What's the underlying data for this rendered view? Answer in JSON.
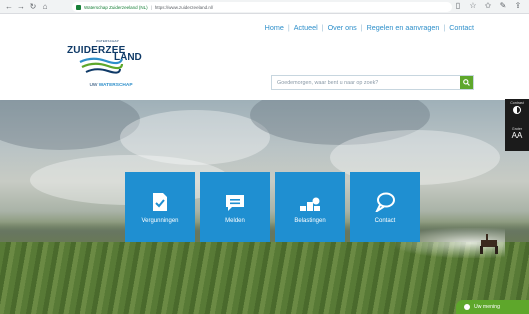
{
  "browser": {
    "site_name": "Waterschap Zuiderzeeland (NL)",
    "url": "https://www.zuiderzeeland.nl/"
  },
  "nav": {
    "items": [
      {
        "label": "Home"
      },
      {
        "label": "Actueel"
      },
      {
        "label": "Over ons"
      },
      {
        "label": "Regelen en aanvragen"
      },
      {
        "label": "Contact"
      }
    ],
    "separator": "|"
  },
  "logo": {
    "small_text": "WATERSCHAP",
    "name_part1": "ZUIDERZEE",
    "name_part2": "LAND",
    "tagline_prefix": "UW",
    "tagline_emph": "WATERSCHAP"
  },
  "search": {
    "placeholder": "Goedemorgen, waar bent u naar op zoek?",
    "button_icon": "search-icon"
  },
  "tiles": [
    {
      "label": "Vergunningen",
      "icon": "document-check-icon"
    },
    {
      "label": "Melden",
      "icon": "chat-lines-icon"
    },
    {
      "label": "Belastingen",
      "icon": "coins-icon"
    },
    {
      "label": "Contact",
      "icon": "speech-bubble-icon"
    }
  ],
  "accessibility": {
    "contrast_label": "Contrast",
    "contrast_icon": "contrast-icon",
    "font_label": "Groter",
    "font_glyph": "AA"
  },
  "feedback": {
    "label": "Uw mening"
  },
  "colors": {
    "brand_blue": "#1f8fd1",
    "brand_green": "#5ea72b",
    "logo_navy": "#0f3a67"
  }
}
